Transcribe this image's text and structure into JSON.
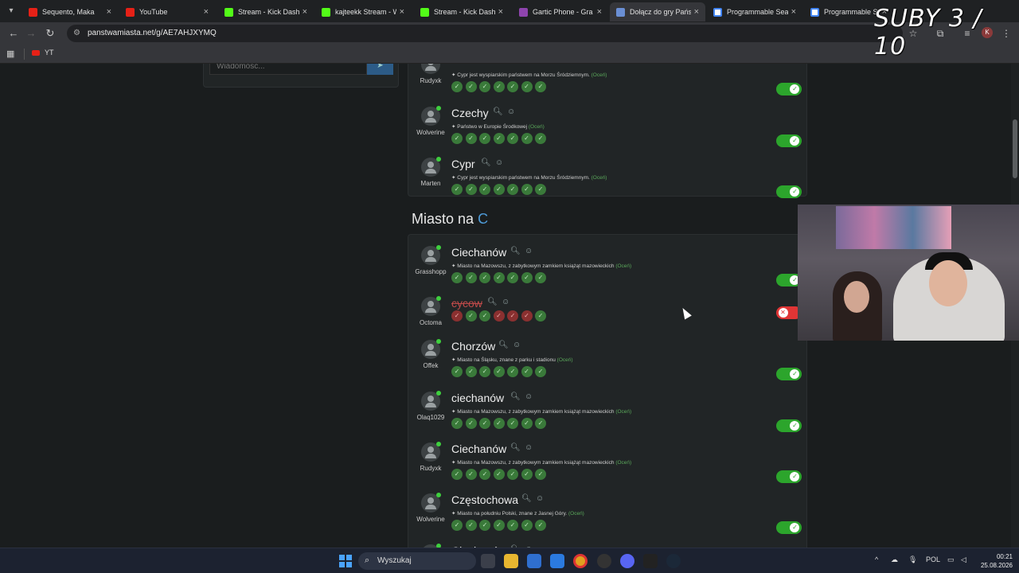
{
  "browser": {
    "tabs": [
      {
        "label": "Sequento, Maka",
        "icon": "youtube-icon"
      },
      {
        "label": "YouTube",
        "icon": "youtube-icon"
      },
      {
        "label": "Stream - Kick Dashbo",
        "icon": "kick-icon"
      },
      {
        "label": "kajteekk Stream - Wa",
        "icon": "kick-icon"
      },
      {
        "label": "Stream - Kick Dashbo",
        "icon": "kick-icon"
      },
      {
        "label": "Gartic Phone - Gra w",
        "icon": "gartic-icon"
      },
      {
        "label": "Dołącz do gry Państw",
        "icon": "globe-icon"
      },
      {
        "label": "Programmable Searc",
        "icon": "google-icon"
      },
      {
        "label": "Programmable Searc",
        "icon": "google-icon"
      }
    ],
    "url": "panstwamiasta.net/g/AE7AHJXYMQ",
    "bookmarks": [
      {
        "label": "YT",
        "icon": "youtube-icon"
      }
    ],
    "profile_initial": "K"
  },
  "chat": {
    "placeholder": "Wiadomość..."
  },
  "country_section": {
    "entries": [
      {
        "player": "Rudyxk",
        "desc": "Cypr jest wyspiarskim państwem na Morzu Śródziemnym.",
        "rate": "(Oceń)",
        "votes": [
          "yes",
          "yes",
          "yes",
          "yes",
          "yes",
          "yes",
          "yes"
        ],
        "accepted": true
      },
      {
        "player": "Wolverine",
        "word": "Czechy",
        "desc": "Państwo w Europie Środkowej",
        "rate": "(Oceń)",
        "votes": [
          "yes",
          "yes",
          "yes",
          "yes",
          "yes",
          "yes",
          "yes"
        ],
        "accepted": true
      },
      {
        "player": "Marten",
        "word": "Cypr",
        "desc": "Cypr jest wyspiarskim państwem na Morzu Śródziemnym.",
        "rate": "(Oceń)",
        "votes": [
          "yes",
          "yes",
          "yes",
          "yes",
          "yes",
          "yes",
          "yes"
        ],
        "accepted": true
      }
    ]
  },
  "city_section": {
    "title_prefix": "Miasto na",
    "letter": "C",
    "entries": [
      {
        "player": "Grasshopp",
        "word": "Ciechanów",
        "desc": "Miasto na Mazowszu, z zabytkowym zamkiem książąt mazowieckich",
        "rate": "(Oceń)",
        "votes": [
          "yes",
          "yes",
          "yes",
          "yes",
          "yes",
          "yes",
          "yes"
        ],
        "accepted": true
      },
      {
        "player": "Octoma",
        "word": "cycow",
        "desc": "",
        "rate": "",
        "votes": [
          "no",
          "yes",
          "yes",
          "no",
          "no",
          "no",
          "yes"
        ],
        "accepted": false
      },
      {
        "player": "Offek",
        "word": "Chorzów",
        "desc": "Miasto na Śląsku, znane z parku i stadionu",
        "rate": "(Oceń)",
        "votes": [
          "yes",
          "yes",
          "yes",
          "yes",
          "yes",
          "yes",
          "yes"
        ],
        "accepted": true
      },
      {
        "player": "Olaq1029",
        "word": "ciechanów",
        "desc": "Miasto na Mazowszu, z zabytkowym zamkiem książąt mazowieckich",
        "rate": "(Oceń)",
        "votes": [
          "yes",
          "yes",
          "yes",
          "yes",
          "yes",
          "yes",
          "yes"
        ],
        "accepted": true
      },
      {
        "player": "Rudyxk",
        "word": "Ciechanów",
        "desc": "Miasto na Mazowszu, z zabytkowym zamkiem książąt mazowieckich",
        "rate": "(Oceń)",
        "votes": [
          "yes",
          "yes",
          "yes",
          "yes",
          "yes",
          "yes",
          "yes"
        ],
        "accepted": true
      },
      {
        "player": "Wolverine",
        "word": "Częstochowa",
        "desc": "Miasto na południu Polski, znane z Jasnej Góry.",
        "rate": "(Oceń)",
        "votes": [
          "yes",
          "yes",
          "yes",
          "yes",
          "yes",
          "yes",
          "yes"
        ],
        "accepted": true
      },
      {
        "player": "",
        "word": "Ciechanów",
        "desc": "",
        "rate": "",
        "votes": [],
        "accepted": true
      }
    ]
  },
  "overlay": {
    "subs_text": "SUBY 3 / 10"
  },
  "taskbar": {
    "search_placeholder": "Wyszukaj",
    "language": "POL",
    "time": "00:21",
    "date": "25.08.2026"
  },
  "colors": {
    "accent": "#4e9bd8",
    "accept": "#2ca52c",
    "reject": "#e03535",
    "vote_yes": "#3a7a3a",
    "vote_no": "#8a3030"
  }
}
